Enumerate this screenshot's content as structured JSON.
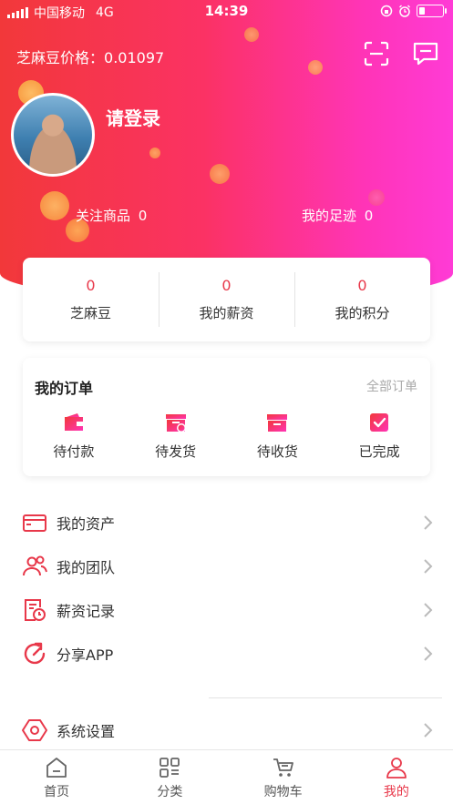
{
  "status_bar": {
    "carrier": "中国移动",
    "network": "4G",
    "time": "14:39"
  },
  "header": {
    "price_label": "芝麻豆价格：",
    "price_value": "0.01097",
    "scan_icon": "scan-icon",
    "message_icon": "message-icon"
  },
  "profile": {
    "login_text": "请登录",
    "follow_label": "关注商品",
    "follow_count": "0",
    "footprint_label": "我的足迹",
    "footprint_count": "0"
  },
  "stats": [
    {
      "value": "0",
      "label": "芝麻豆"
    },
    {
      "value": "0",
      "label": "我的薪资"
    },
    {
      "value": "0",
      "label": "我的积分"
    }
  ],
  "orders": {
    "title": "我的订单",
    "all_link": "全部订单",
    "items": [
      {
        "label": "待付款",
        "icon": "wallet-icon"
      },
      {
        "label": "待发货",
        "icon": "pending-shipment-icon"
      },
      {
        "label": "待收货",
        "icon": "box-icon"
      },
      {
        "label": "已完成",
        "icon": "completed-check-icon"
      }
    ]
  },
  "menu": [
    {
      "label": "我的资产",
      "icon": "wallet-outline-icon"
    },
    {
      "label": "我的团队",
      "icon": "team-icon"
    },
    {
      "label": "薪资记录",
      "icon": "salary-record-icon"
    },
    {
      "label": "分享APP",
      "icon": "share-icon"
    },
    {
      "label": "系统设置",
      "icon": "settings-icon"
    }
  ],
  "tabbar": [
    {
      "label": "首页",
      "icon": "home-icon"
    },
    {
      "label": "分类",
      "icon": "category-icon"
    },
    {
      "label": "购物车",
      "icon": "cart-icon"
    },
    {
      "label": "我的",
      "icon": "user-icon"
    }
  ],
  "colors": {
    "accent": "#e8384a",
    "gradient_start": "#f2383a",
    "gradient_end": "#ff3bd6"
  }
}
